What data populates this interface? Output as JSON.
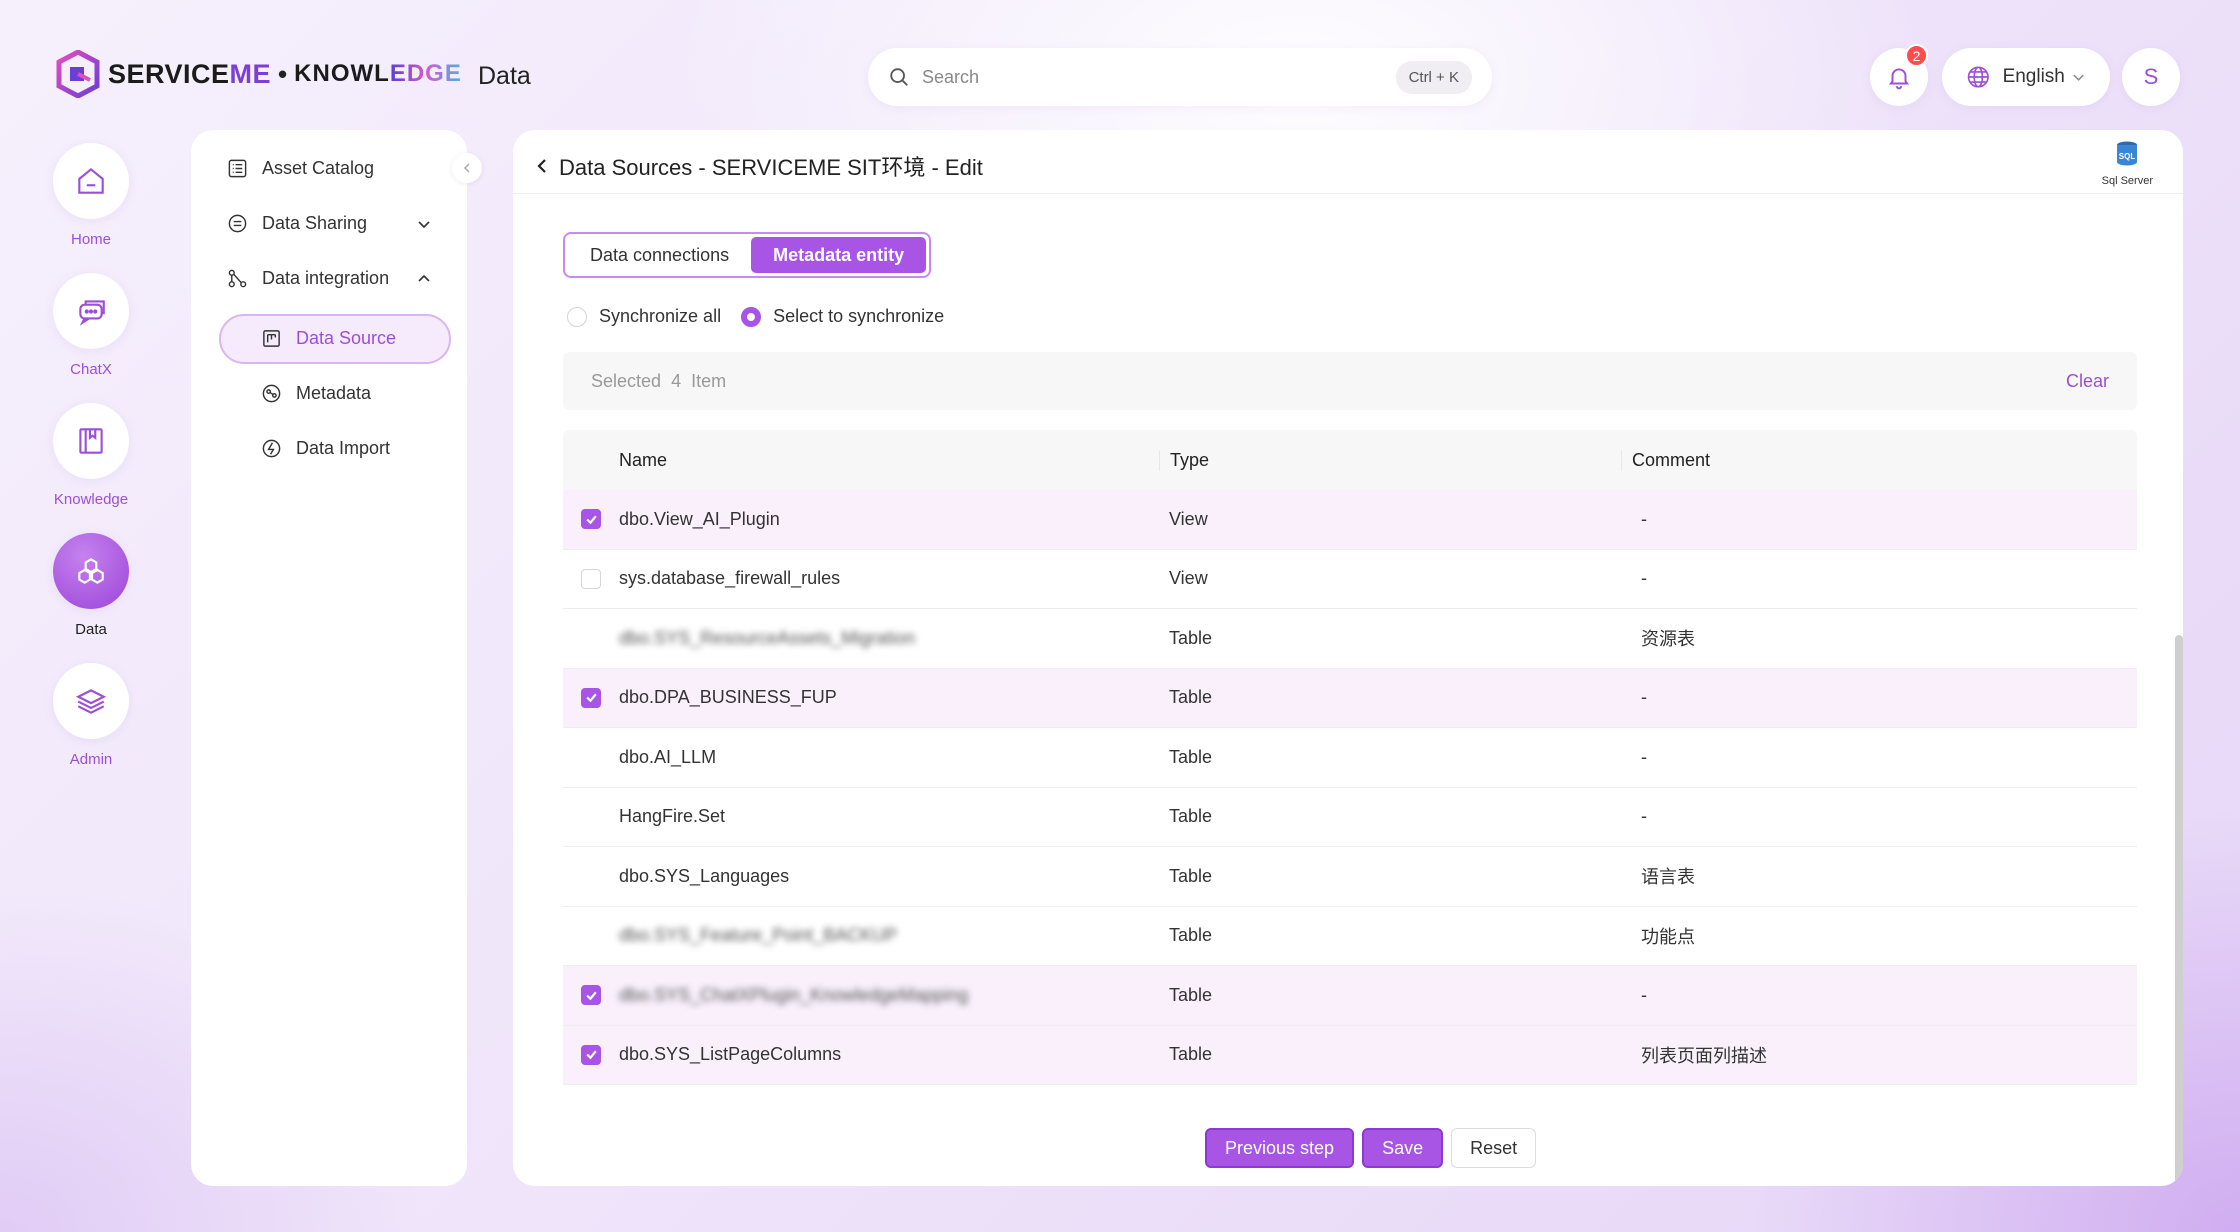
{
  "header": {
    "brand": "SERVICE",
    "brand_accent": "ME",
    "brand_dot": "•",
    "brand2_a": "KNOWL",
    "brand2_b": "EDGE",
    "app_name": "Data",
    "search_placeholder": "Search",
    "search_shortcut": "Ctrl + K",
    "notification_count": "2",
    "language": "English",
    "avatar_letter": "S"
  },
  "rail": [
    {
      "label": "Home",
      "icon": "home-icon"
    },
    {
      "label": "ChatX",
      "icon": "chat-icon"
    },
    {
      "label": "Knowledge",
      "icon": "book-icon"
    },
    {
      "label": "Data",
      "icon": "data-icon",
      "active": true
    },
    {
      "label": "Admin",
      "icon": "layers-icon"
    }
  ],
  "side_menu": {
    "asset_catalog": "Asset Catalog",
    "data_sharing": "Data Sharing",
    "data_integration": "Data integration",
    "data_source": "Data Source",
    "metadata": "Metadata",
    "data_import": "Data Import"
  },
  "main": {
    "title": "Data Sources - SERVICEME SIT环境 - Edit",
    "db_type": "Sql Server",
    "tabs": [
      "Data connections",
      "Metadata entity"
    ],
    "sync_all": "Synchronize all",
    "sync_select": "Select to synchronize",
    "selected_label": "Selected",
    "selected_count": "4",
    "selected_unit": "Item",
    "clear": "Clear",
    "columns": {
      "name": "Name",
      "type": "Type",
      "comment": "Comment"
    },
    "rows": [
      {
        "name": "dbo.View_AI_Plugin",
        "type": "View",
        "comment": "-"
      },
      {
        "name": "sys.database_firewall_rules",
        "type": "View",
        "comment": "-"
      },
      {
        "name": "dbo.SYS_ResourceAssets_Migration",
        "type": "Table",
        "comment": "资源表"
      },
      {
        "name": "dbo.DPA_BUSINESS_FUP",
        "type": "Table",
        "comment": "-"
      },
      {
        "name": "dbo.AI_LLM",
        "type": "Table",
        "comment": "-"
      },
      {
        "name": "HangFire.Set",
        "type": "Table",
        "comment": "-"
      },
      {
        "name": "dbo.SYS_Languages",
        "type": "Table",
        "comment": "语言表"
      },
      {
        "name": "dbo.SYS_Feature_Point_BACKUP",
        "type": "Table",
        "comment": "功能点"
      },
      {
        "name": "dbo.SYS_ChatXPlugin_KnowledgeMapping",
        "type": "Table",
        "comment": "-"
      },
      {
        "name": "dbo.SYS_ListPageColumns",
        "type": "Table",
        "comment": "列表页面列描述"
      }
    ],
    "buttons": {
      "previous": "Previous step",
      "save": "Save",
      "reset": "Reset"
    }
  },
  "colors": {
    "accent": "#a855e5",
    "accent_text": "#9b4fd6",
    "badge": "#ff4d4f"
  }
}
